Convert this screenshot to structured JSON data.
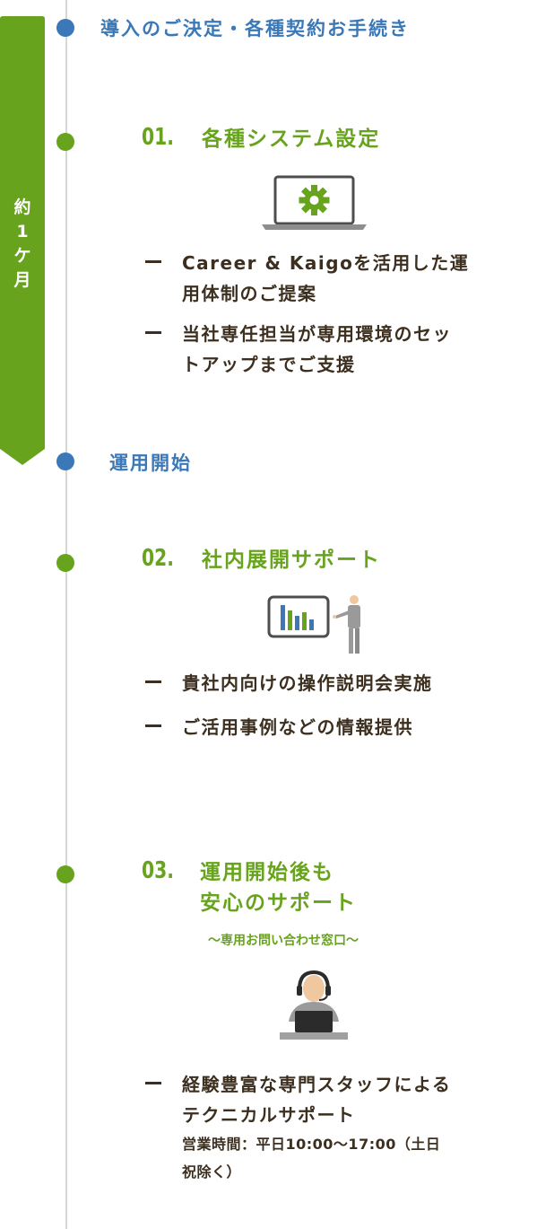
{
  "period": {
    "label_chars": [
      "約",
      "1",
      "ケ",
      "月"
    ]
  },
  "milestones": [
    {
      "label": "導入のご決定・各種契約お手続き"
    },
    {
      "label": "運用開始"
    }
  ],
  "steps": [
    {
      "number": "01.",
      "title_lines": [
        "各種システム設定"
      ],
      "subtitle": "",
      "icon": "laptop-gear-icon",
      "bullets": [
        {
          "lines": [
            "Career & Kaigoを活用した運",
            "用体制のご提案"
          ]
        },
        {
          "lines": [
            "当社専任担当が専用環境のセッ",
            "トアップまでご支援"
          ]
        }
      ]
    },
    {
      "number": "02.",
      "title_lines": [
        "社内展開サポート"
      ],
      "subtitle": "",
      "icon": "presentation-icon",
      "bullets": [
        {
          "lines": [
            "貴社内向けの操作説明会実施"
          ]
        },
        {
          "lines": [
            "ご活用事例などの情報提供"
          ]
        }
      ]
    },
    {
      "number": "03.",
      "title_lines": [
        "運用開始後も",
        "安心のサポート"
      ],
      "subtitle": "〜専用お問い合わせ窓口〜",
      "icon": "support-operator-icon",
      "bullets": [
        {
          "lines": [
            "経験豊富な専門スタッフによる",
            "テクニカルサポート"
          ],
          "note_lines": [
            "営業時間：平日10:00〜17:00（土日",
            "祝除く）"
          ]
        }
      ]
    }
  ],
  "colors": {
    "green": "#67a31c",
    "blue": "#3a78b8",
    "text": "#3c2f1f",
    "line": "#d6d6d6"
  }
}
